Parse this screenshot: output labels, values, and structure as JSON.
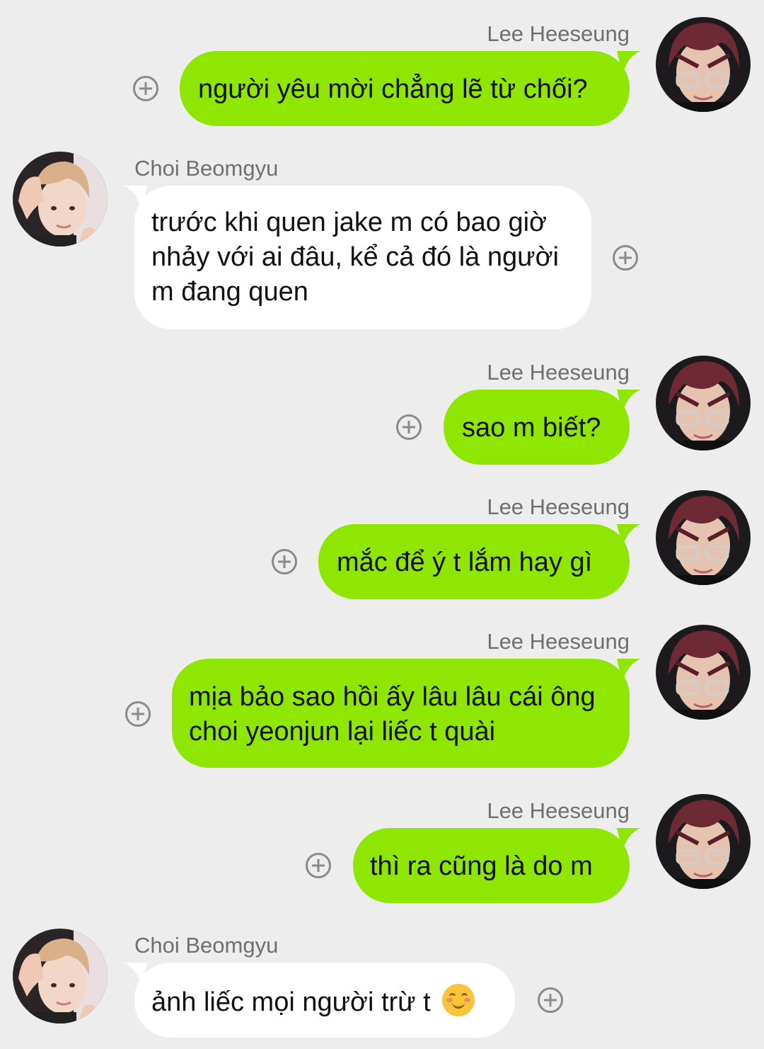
{
  "colors": {
    "background": "#ededed",
    "sent_bubble": "#8fe600",
    "received_bubble": "#ffffff",
    "name_text": "#6f6f6f"
  },
  "messages": [
    {
      "sender": "Lee Heeseung",
      "side": "right",
      "text": "người yêu mời chẳng lẽ từ chối?"
    },
    {
      "sender": "Choi Beomgyu",
      "side": "left",
      "text": "trước khi quen jake m có bao giờ nhảy với ai đâu, kể cả đó là người m đang quen"
    },
    {
      "sender": "Lee Heeseung",
      "side": "right",
      "text": "sao m biết?"
    },
    {
      "sender": "Lee Heeseung",
      "side": "right",
      "text": "mắc để ý t lắm hay gì"
    },
    {
      "sender": "Lee Heeseung",
      "side": "right",
      "text": "mịa bảo sao hồi ấy lâu lâu cái ông choi yeonjun lại liếc t quài"
    },
    {
      "sender": "Lee Heeseung",
      "side": "right",
      "text": "thì ra cũng là do m"
    },
    {
      "sender": "Choi Beomgyu",
      "side": "left",
      "text": "ảnh liếc mọi người trừ t",
      "emoji": "smiling-face-emoji"
    }
  ],
  "icons": {
    "avatar_right": "avatar-lee-heeseung",
    "avatar_left": "avatar-choi-beomgyu",
    "add": "plus-circle-icon"
  }
}
